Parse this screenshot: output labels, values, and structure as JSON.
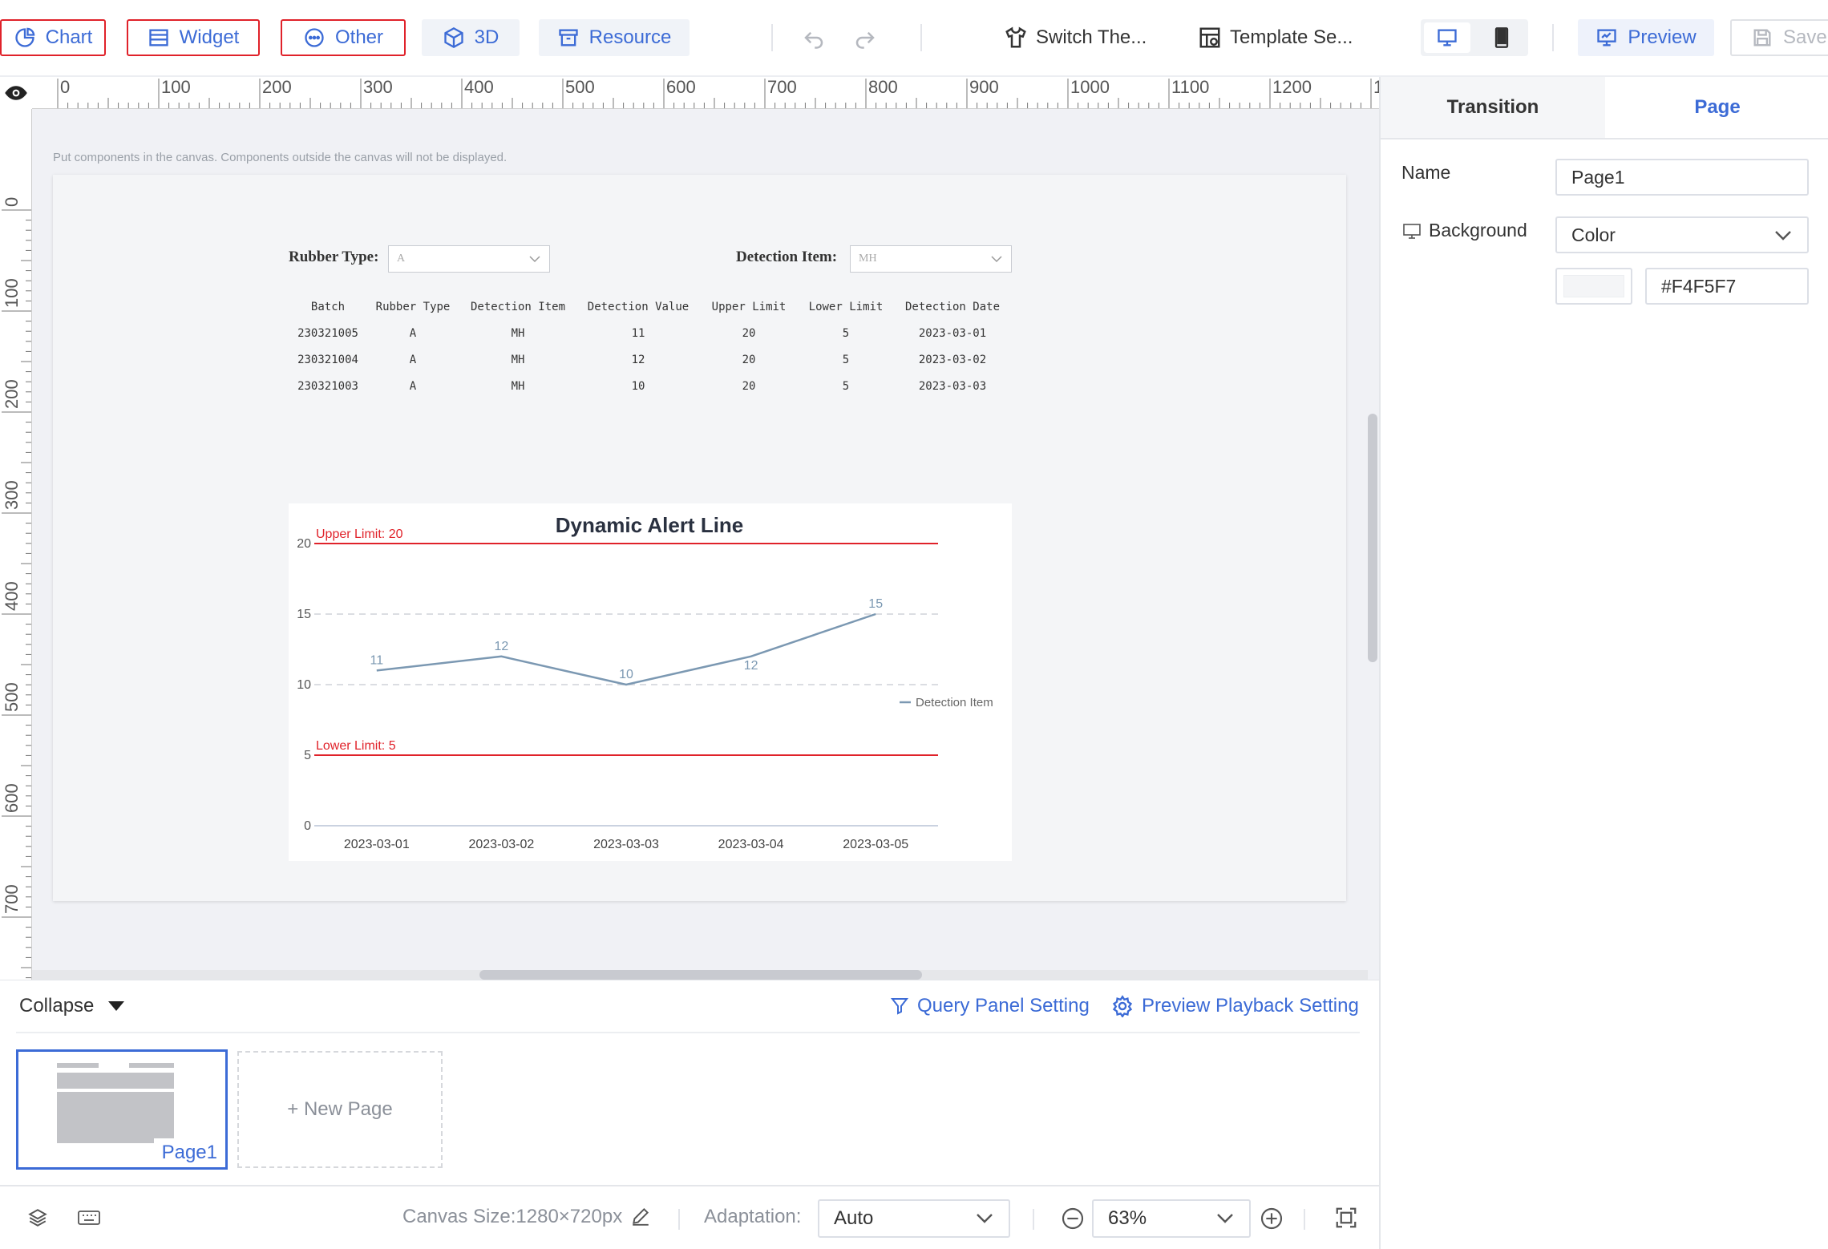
{
  "toolbar": {
    "chart_label": "Chart",
    "widget_label": "Widget",
    "other_label": "Other",
    "threed_label": "3D",
    "resource_label": "Resource",
    "switch_theme_label": "Switch The...",
    "template_label": "Template Se...",
    "preview_label": "Preview",
    "save_label": "Save"
  },
  "canvas": {
    "hint": "Put components in the canvas. Components outside the canvas will not be displayed.",
    "filters": {
      "rubber_label": "Rubber Type:",
      "rubber_value": "A",
      "detection_label": "Detection Item:",
      "detection_value": "MH"
    },
    "table": {
      "headers": [
        "Batch",
        "Rubber Type",
        "Detection Item",
        "Detection Value",
        "Upper Limit",
        "Lower Limit",
        "Detection Date"
      ],
      "rows": [
        [
          "230321005",
          "A",
          "MH",
          "11",
          "20",
          "5",
          "2023-03-01"
        ],
        [
          "230321004",
          "A",
          "MH",
          "12",
          "20",
          "5",
          "2023-03-02"
        ],
        [
          "230321003",
          "A",
          "MH",
          "10",
          "20",
          "5",
          "2023-03-03"
        ]
      ]
    }
  },
  "chart_data": {
    "type": "line",
    "title": "Dynamic Alert Line",
    "categories": [
      "2023-03-01",
      "2023-03-02",
      "2023-03-03",
      "2023-03-04",
      "2023-03-05"
    ],
    "series": [
      {
        "name": "Detection Item",
        "values": [
          11,
          12,
          10,
          12,
          15
        ]
      }
    ],
    "ylim": [
      0,
      20
    ],
    "yticks": [
      0,
      5,
      10,
      15,
      20
    ],
    "alert_lines": [
      {
        "label": "Upper Limit: 20",
        "value": 20
      },
      {
        "label": "Lower Limit: 5",
        "value": 5
      }
    ],
    "legend": "right",
    "grid": true,
    "colors": {
      "series": "#7b98b2",
      "alert": "#e0222a"
    }
  },
  "right_panel": {
    "tab_transition": "Transition",
    "tab_page": "Page",
    "name_label": "Name",
    "name_value": "Page1",
    "background_label": "Background",
    "background_type": "Color",
    "background_color": "#F4F5F7"
  },
  "bottom": {
    "collapse_label": "Collapse",
    "query_panel_label": "Query Panel Setting",
    "playback_label": "Preview Playback Setting",
    "page1_label": "Page1",
    "new_page_label": "+ New Page"
  },
  "statusbar": {
    "canvas_size": "Canvas Size:1280×720px",
    "adaptation_label": "Adaptation:",
    "adaptation_value": "Auto",
    "zoom_value": "63%"
  },
  "colors": {
    "accent": "#3c6bd6",
    "highlight_border": "#e0222a"
  }
}
